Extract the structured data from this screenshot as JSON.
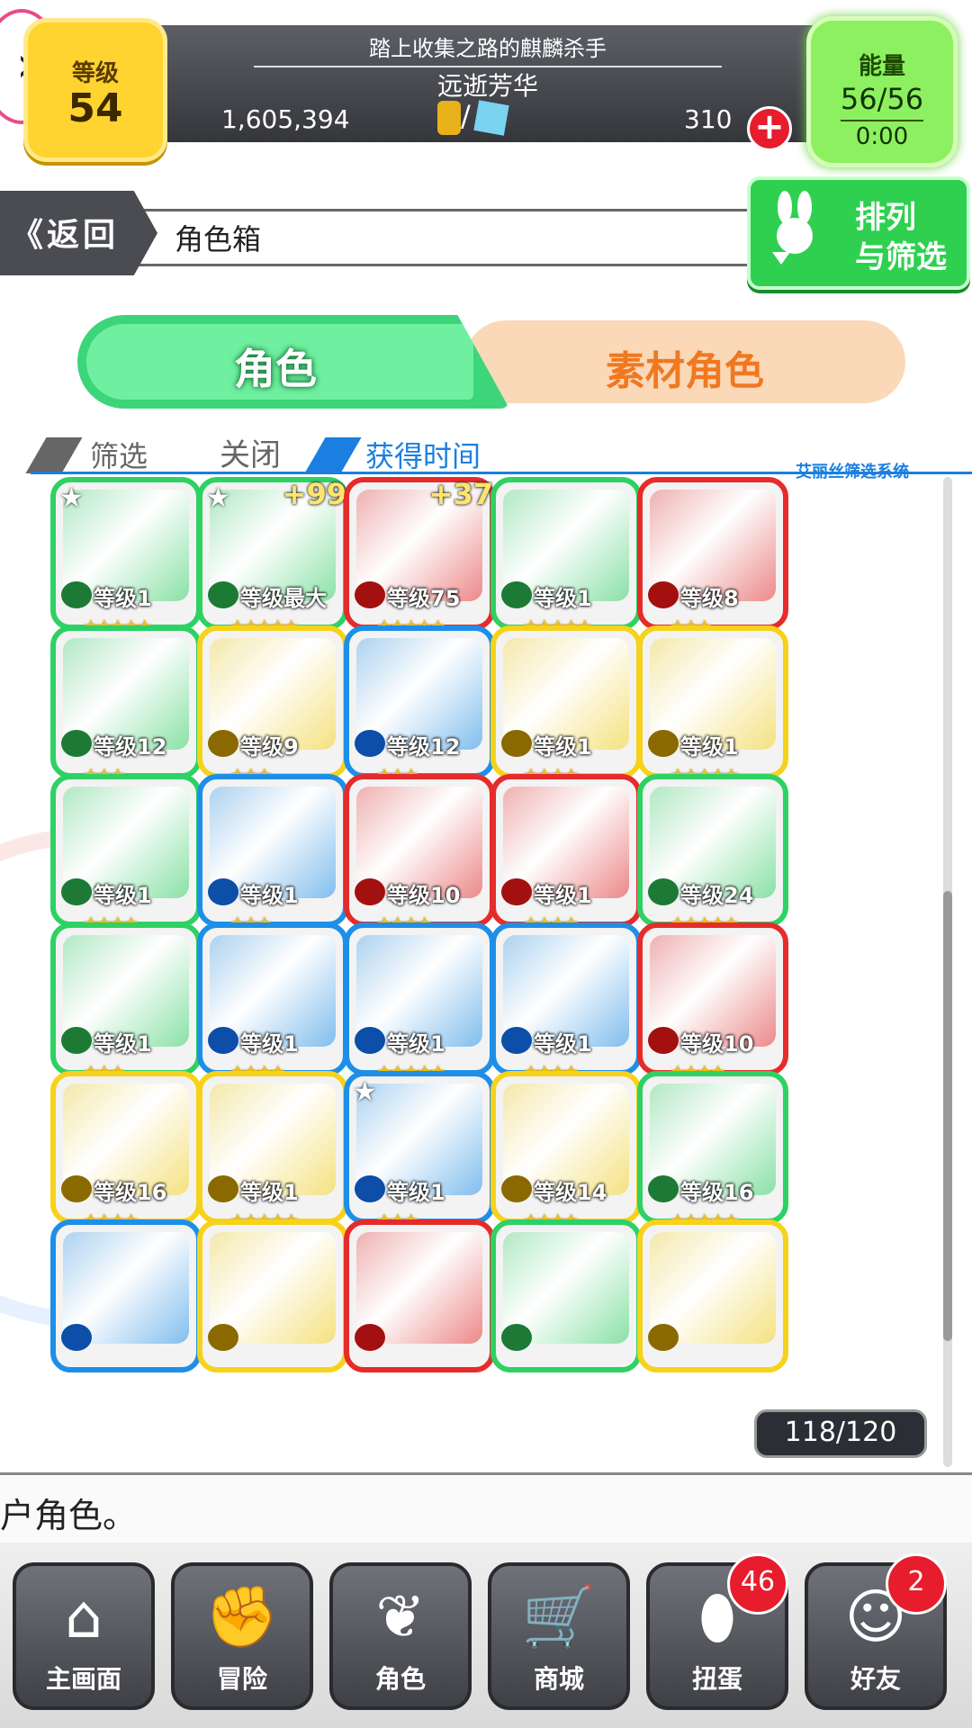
{
  "header": {
    "level_label": "等级",
    "level_value": "54",
    "title_top": "踏上收集之路的麒麟杀手",
    "title_bottom": "远逝芳华",
    "gold": "1,605,394",
    "currency_separator": "/",
    "stones": "310",
    "add_label": "+",
    "energy_label": "能量",
    "energy_value": "56/56",
    "energy_timer": "0:00",
    "menu_arrow": "›"
  },
  "nav": {
    "back_label": "《返回",
    "page_title": "角色箱",
    "sort_line1": "排列",
    "sort_line2": "与筛选"
  },
  "tabs": {
    "role": "角色",
    "material": "素材角色"
  },
  "filter": {
    "label": "筛选",
    "value": "关闭",
    "sort_key": "获得时间",
    "system_name": "艾丽丝筛选系统"
  },
  "cards": [
    {
      "color": "#2ed163",
      "elem": "wood",
      "level": "等级1",
      "stars": "★★★★★",
      "plus": "",
      "starmark": "★"
    },
    {
      "color": "#2ed163",
      "elem": "wood",
      "level": "等级最大",
      "stars": "★★★★★",
      "plus": "+99",
      "starmark": "★"
    },
    {
      "color": "#e62b2b",
      "elem": "fire",
      "level": "等级75",
      "stars": "★★★★★",
      "plus": "+37",
      "starmark": ""
    },
    {
      "color": "#2ed163",
      "elem": "wood",
      "level": "等级1",
      "stars": "★★★★★",
      "plus": "",
      "starmark": ""
    },
    {
      "color": "#e62b2b",
      "elem": "fire",
      "level": "等级8",
      "stars": "★★★",
      "plus": "",
      "starmark": ""
    },
    {
      "color": "#2ed163",
      "elem": "wood",
      "level": "等级12",
      "stars": "★★★",
      "plus": "",
      "starmark": ""
    },
    {
      "color": "#f6d21a",
      "elem": "light",
      "level": "等级9",
      "stars": "★★★",
      "plus": "",
      "starmark": ""
    },
    {
      "color": "#1e8fe8",
      "elem": "water",
      "level": "等级12",
      "stars": "★★★",
      "plus": "",
      "starmark": ""
    },
    {
      "color": "#f6d21a",
      "elem": "light",
      "level": "等级1",
      "stars": "★★★★",
      "plus": "",
      "starmark": ""
    },
    {
      "color": "#f6d21a",
      "elem": "light",
      "level": "等级1",
      "stars": "★★★★★",
      "plus": "",
      "starmark": ""
    },
    {
      "color": "#2ed163",
      "elem": "wood",
      "level": "等级1",
      "stars": "★★★★",
      "plus": "",
      "starmark": ""
    },
    {
      "color": "#1e8fe8",
      "elem": "water",
      "level": "等级1",
      "stars": "★★★",
      "plus": "",
      "starmark": ""
    },
    {
      "color": "#e62b2b",
      "elem": "fire",
      "level": "等级10",
      "stars": "★★★★",
      "plus": "",
      "starmark": ""
    },
    {
      "color": "#e62b2b",
      "elem": "fire",
      "level": "等级1",
      "stars": "★★★★",
      "plus": "",
      "starmark": ""
    },
    {
      "color": "#2ed163",
      "elem": "wood",
      "level": "等级24",
      "stars": "★★★★★",
      "plus": "",
      "starmark": ""
    },
    {
      "color": "#2ed163",
      "elem": "wood",
      "level": "等级1",
      "stars": "★★★",
      "plus": "",
      "starmark": ""
    },
    {
      "color": "#1e8fe8",
      "elem": "water",
      "level": "等级1",
      "stars": "★★★★",
      "plus": "",
      "starmark": ""
    },
    {
      "color": "#1e8fe8",
      "elem": "water",
      "level": "等级1",
      "stars": "★★★★★",
      "plus": "",
      "starmark": ""
    },
    {
      "color": "#1e8fe8",
      "elem": "water",
      "level": "等级1",
      "stars": "★★★★",
      "plus": "",
      "starmark": ""
    },
    {
      "color": "#e62b2b",
      "elem": "fire",
      "level": "等级10",
      "stars": "★★★★",
      "plus": "",
      "starmark": ""
    },
    {
      "color": "#f6d21a",
      "elem": "light",
      "level": "等级16",
      "stars": "★★★★",
      "plus": "",
      "starmark": ""
    },
    {
      "color": "#f6d21a",
      "elem": "light",
      "level": "等级1",
      "stars": "★★★★★",
      "plus": "",
      "starmark": ""
    },
    {
      "color": "#1e8fe8",
      "elem": "water",
      "level": "等级1",
      "stars": "★★★",
      "plus": "",
      "starmark": "★"
    },
    {
      "color": "#f6d21a",
      "elem": "light",
      "level": "等级14",
      "stars": "★★★★",
      "plus": "",
      "starmark": ""
    },
    {
      "color": "#2ed163",
      "elem": "wood",
      "level": "等级16",
      "stars": "★★★★★",
      "plus": "",
      "starmark": ""
    },
    {
      "color": "#1e8fe8",
      "elem": "water",
      "level": "",
      "stars": "",
      "plus": "",
      "starmark": ""
    },
    {
      "color": "#f6d21a",
      "elem": "light",
      "level": "",
      "stars": "",
      "plus": "",
      "starmark": ""
    },
    {
      "color": "#e62b2b",
      "elem": "fire",
      "level": "",
      "stars": "",
      "plus": "",
      "starmark": ""
    },
    {
      "color": "#2ed163",
      "elem": "wood",
      "level": "",
      "stars": "",
      "plus": "",
      "starmark": ""
    },
    {
      "color": "#f6d21a",
      "elem": "light",
      "level": "",
      "stars": "",
      "plus": "",
      "starmark": ""
    }
  ],
  "box_count": "118/120",
  "message": "户角色。",
  "bottom_nav": [
    {
      "label": "主画面",
      "icon": "home-icon",
      "glyph": "⌂",
      "badge": ""
    },
    {
      "label": "冒险",
      "icon": "handshake-icon",
      "glyph": "✊",
      "badge": ""
    },
    {
      "label": "角色",
      "icon": "bunny-icon",
      "glyph": "❦",
      "badge": ""
    },
    {
      "label": "商城",
      "icon": "cart-icon",
      "glyph": "🛒",
      "badge": ""
    },
    {
      "label": "扭蛋",
      "icon": "egg-icon",
      "glyph": "⬮",
      "badge": "46"
    },
    {
      "label": "好友",
      "icon": "friends-icon",
      "glyph": "☺",
      "badge": "2"
    }
  ]
}
